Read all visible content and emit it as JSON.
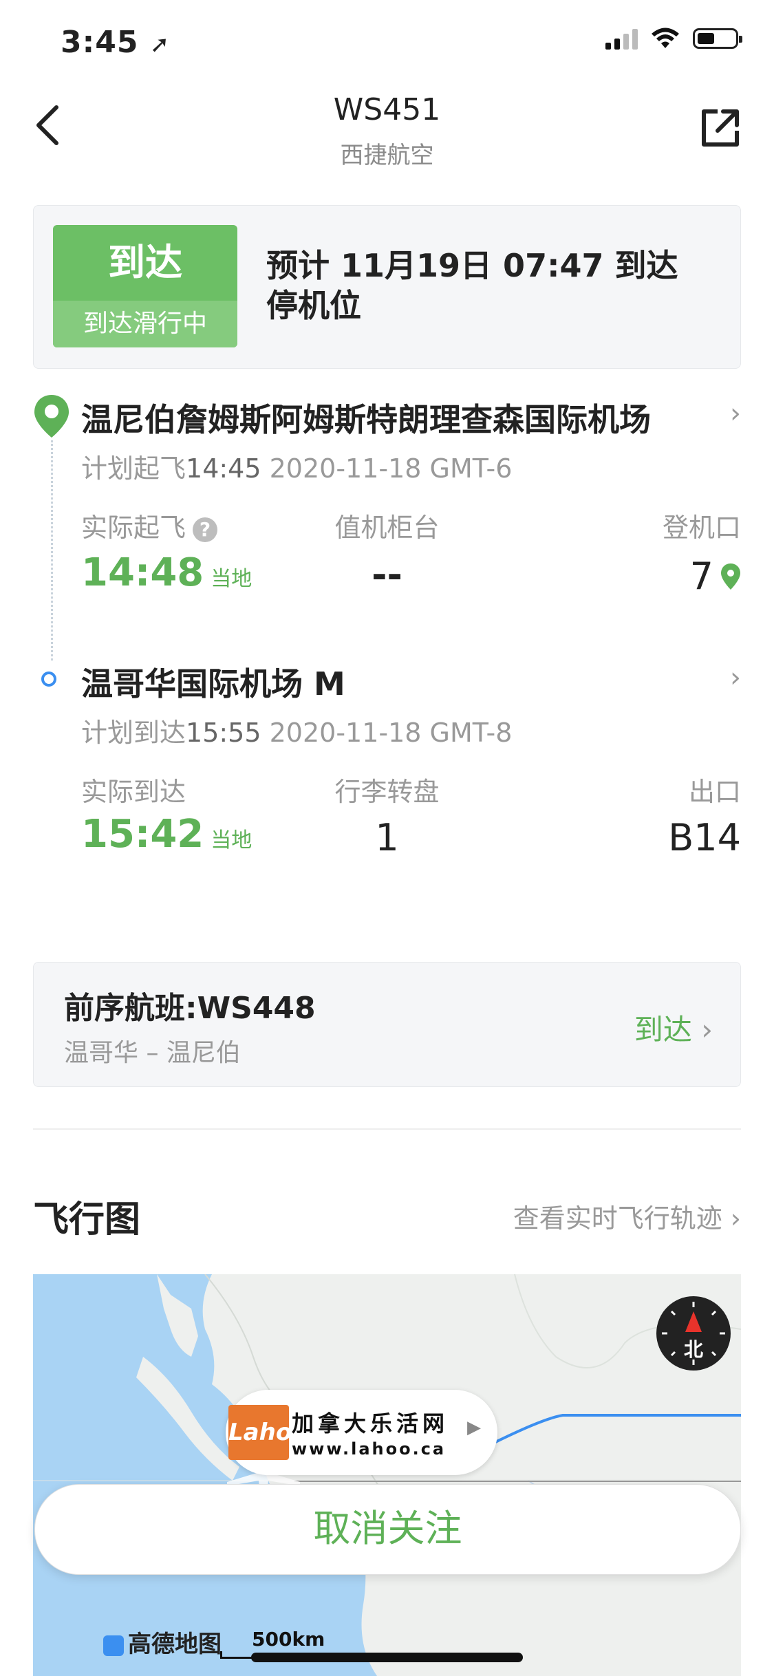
{
  "status_bar": {
    "time": "3:45"
  },
  "nav": {
    "title": "WS451",
    "subtitle": "西捷航空"
  },
  "status_card": {
    "badge_main": "到达",
    "badge_sub": "到达滑行中",
    "line1": "预计 11月19日 07:47 到达",
    "line2": "停机位"
  },
  "departure": {
    "airport": "温尼伯詹姆斯阿姆斯特朗理查森国际机场",
    "sched_label": "计划起飞",
    "sched_time": "14:45",
    "sched_date": "2020-11-18  GMT-6",
    "actual_label": "实际起飞",
    "actual_time": "14:48",
    "local_tag": "当地",
    "checkin_label": "值机柜台",
    "checkin_value": "--",
    "gate_label": "登机口",
    "gate_value": "7"
  },
  "arrival": {
    "airport": "温哥华国际机场 M",
    "sched_label": "计划到达",
    "sched_time": "15:55",
    "sched_date": "2020-11-18  GMT-8",
    "actual_label": "实际到达",
    "actual_time": "15:42",
    "local_tag": "当地",
    "baggage_label": "行李转盘",
    "baggage_value": "1",
    "exit_label": "出口",
    "exit_value": "B14"
  },
  "previous_flight": {
    "title": "前序航班:WS448",
    "route": "温哥华 – 温尼伯",
    "status": "到达"
  },
  "flight_map": {
    "title": "飞行图",
    "link": "查看实时飞行轨迹",
    "compass_label": "北",
    "scale": "500km",
    "provider": "高德地图",
    "watermark_cn": "加拿大乐活网",
    "watermark_url": "www.lahoo.ca",
    "watermark_logo": "Lahoo"
  },
  "unfollow_button": "取消关注",
  "colors": {
    "accent_green": "#5eb157",
    "route_blue": "#3b8ff0",
    "water": "#a9d3f4"
  }
}
